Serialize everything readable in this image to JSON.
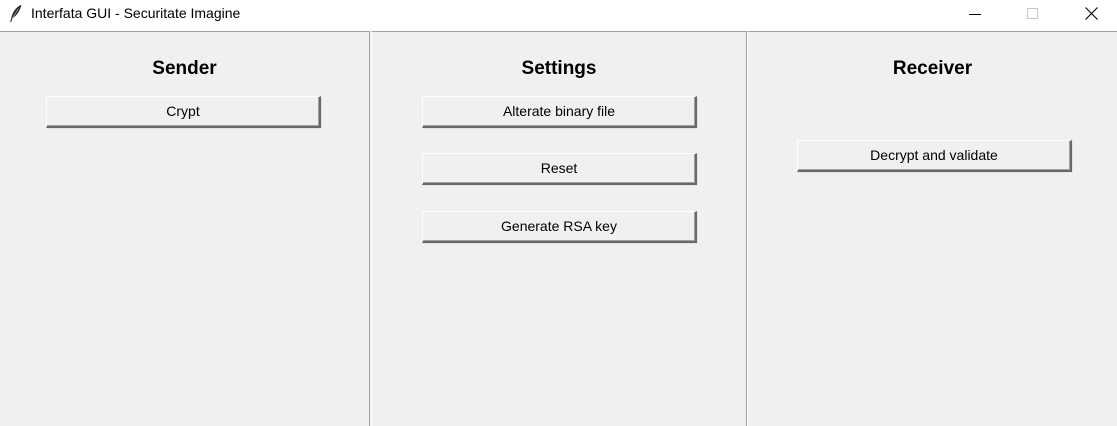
{
  "window": {
    "title": "Interfata GUI - Securitate Imagine",
    "app_icon": "feather-icon",
    "controls": {
      "minimize_icon": "minimize-icon",
      "maximize_icon": "maximize-icon",
      "close_icon": "close-icon"
    }
  },
  "sender": {
    "title": "Sender",
    "buttons": [
      {
        "label": "Crypt"
      }
    ]
  },
  "settings": {
    "title": "Settings",
    "buttons": [
      {
        "label": "Alterate binary file"
      },
      {
        "label": "Reset"
      },
      {
        "label": "Generate RSA key"
      }
    ]
  },
  "receiver": {
    "title": "Receiver",
    "buttons": [
      {
        "label": "Decrypt and validate"
      }
    ]
  }
}
